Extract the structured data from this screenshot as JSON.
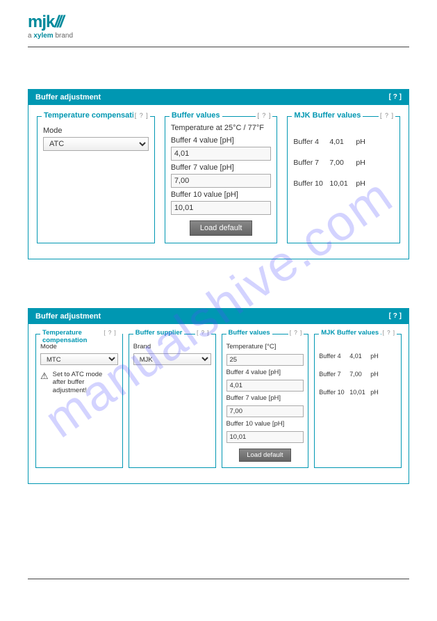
{
  "logo": {
    "text": "mjk",
    "tagline_prefix": "a ",
    "tagline_brand": "xylem",
    "tagline_suffix": " brand"
  },
  "watermark": "manualshive.com",
  "panel1": {
    "title": "Buffer adjustment",
    "help": "[ ? ]",
    "tempcomp": {
      "legend": "Temperature compensation",
      "help": "[ ? ]",
      "mode_label": "Mode",
      "mode_value": "ATC"
    },
    "buffervalues": {
      "legend": "Buffer values",
      "help": "[ ? ]",
      "temp_text": "Temperature at 25°C / 77°F",
      "b4_label": "Buffer 4 value [pH]",
      "b4_value": "4,01",
      "b7_label": "Buffer 7 value [pH]",
      "b7_value": "7,00",
      "b10_label": "Buffer 10 value [pH]",
      "b10_value": "10,01",
      "load_default": "Load default"
    },
    "mjk": {
      "legend": "MJK Buffer values",
      "help": "[ ? ]",
      "r1": {
        "name": "Buffer 4",
        "val": "4,01",
        "unit": "pH"
      },
      "r2": {
        "name": "Buffer 7",
        "val": "7,00",
        "unit": "pH"
      },
      "r3": {
        "name": "Buffer 10",
        "val": "10,01",
        "unit": "pH"
      }
    }
  },
  "panel2": {
    "title": "Buffer adjustment",
    "help": "[ ? ]",
    "tempcomp": {
      "legend": "Temperature compensation",
      "help": "[ ? ]",
      "mode_label": "Mode",
      "mode_value": "MTC",
      "warn_line1": "Set to ATC mode",
      "warn_line2": "after buffer adjustment!"
    },
    "supplier": {
      "legend": "Buffer supplier",
      "help": "[ ? ]",
      "brand_label": "Brand",
      "brand_value": "MJK"
    },
    "buffervalues": {
      "legend": "Buffer values",
      "help": "[ ? ]",
      "temp_label": "Temperature  [°C]",
      "temp_value": "25",
      "b4_label": "Buffer 4 value [pH]",
      "b4_value": "4,01",
      "b7_label": "Buffer 7 value [pH]",
      "b7_value": "7,00",
      "b10_label": "Buffer 10 value [pH]",
      "b10_value": "10,01",
      "load_default": "Load default"
    },
    "mjk": {
      "legend": "MJK Buffer values",
      "help": "[ ? ]",
      "r1": {
        "name": "Buffer 4",
        "val": "4,01",
        "unit": "pH"
      },
      "r2": {
        "name": "Buffer 7",
        "val": "7,00",
        "unit": "pH"
      },
      "r3": {
        "name": "Buffer 10",
        "val": "10,01",
        "unit": "pH"
      }
    }
  }
}
